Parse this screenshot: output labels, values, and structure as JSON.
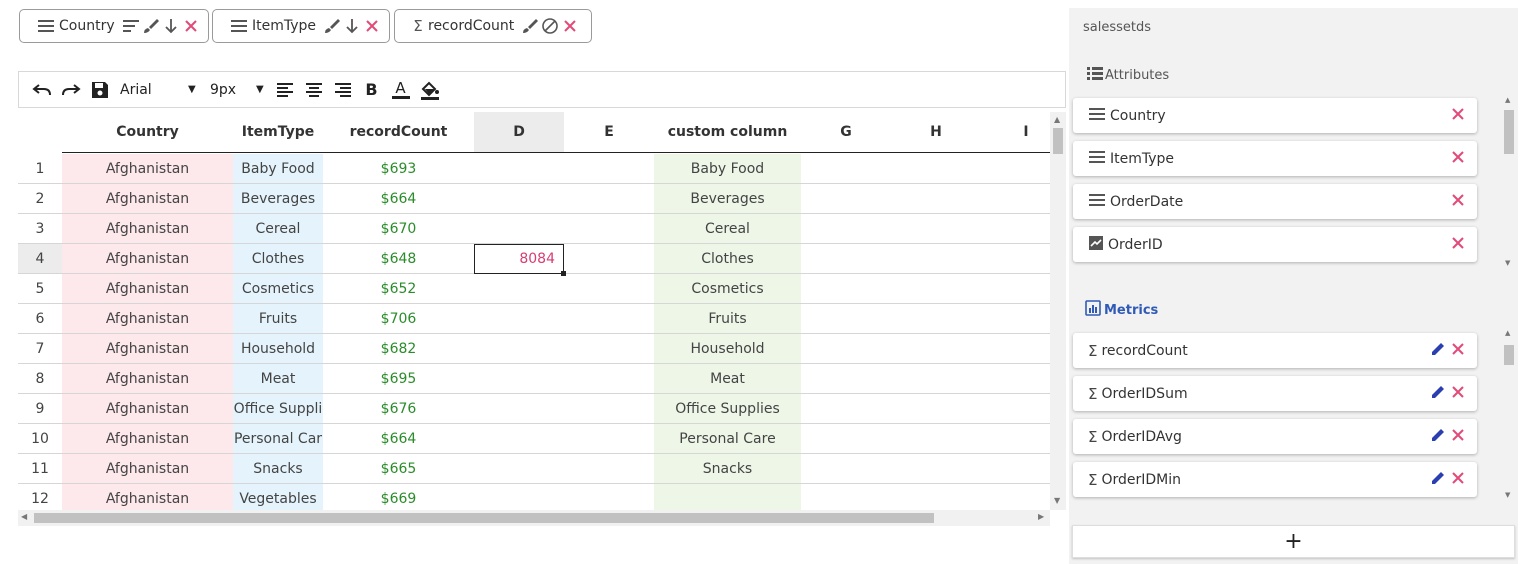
{
  "chips": [
    {
      "label": "Country"
    },
    {
      "label": "ItemType"
    },
    {
      "label": "recordCount"
    }
  ],
  "toolbar": {
    "font_family": "Arial",
    "font_size": "9px",
    "bold_label": "B",
    "text_color_label": "A"
  },
  "grid": {
    "columns": [
      "Country",
      "ItemType",
      "recordCount",
      "D",
      "E",
      "custom column",
      "G",
      "H",
      "I"
    ],
    "rows": [
      {
        "num": "1",
        "country": "Afghanistan",
        "item": "Baby Food",
        "count": "$693",
        "custom": "Baby Food"
      },
      {
        "num": "2",
        "country": "Afghanistan",
        "item": "Beverages",
        "count": "$664",
        "custom": "Beverages"
      },
      {
        "num": "3",
        "country": "Afghanistan",
        "item": "Cereal",
        "count": "$670",
        "custom": "Cereal"
      },
      {
        "num": "4",
        "country": "Afghanistan",
        "item": "Clothes",
        "count": "$648",
        "custom": "Clothes"
      },
      {
        "num": "5",
        "country": "Afghanistan",
        "item": "Cosmetics",
        "count": "$652",
        "custom": "Cosmetics"
      },
      {
        "num": "6",
        "country": "Afghanistan",
        "item": "Fruits",
        "count": "$706",
        "custom": "Fruits"
      },
      {
        "num": "7",
        "country": "Afghanistan",
        "item": "Household",
        "count": "$682",
        "custom": "Household"
      },
      {
        "num": "8",
        "country": "Afghanistan",
        "item": "Meat",
        "count": "$695",
        "custom": "Meat"
      },
      {
        "num": "9",
        "country": "Afghanistan",
        "item": "Office Suppli",
        "count": "$676",
        "custom": "Office Supplies"
      },
      {
        "num": "10",
        "country": "Afghanistan",
        "item": "Personal Car",
        "count": "$664",
        "custom": "Personal Care"
      },
      {
        "num": "11",
        "country": "Afghanistan",
        "item": "Snacks",
        "count": "$665",
        "custom": "Snacks"
      },
      {
        "num": "12",
        "country": "Afghanistan",
        "item": "Vegetables",
        "count": "$669",
        "custom": ""
      }
    ],
    "selected_cell_value": "8084"
  },
  "panel": {
    "dataset_name": "salessetds",
    "attributes_title": "Attributes",
    "attributes": [
      "Country",
      "ItemType",
      "OrderDate",
      "OrderID"
    ],
    "metrics_title": "Metrics",
    "metrics": [
      "recordCount",
      "OrderIDSum",
      "OrderIDAvg",
      "OrderIDMin"
    ],
    "add_label": "+"
  },
  "colors": {
    "accent_pink": "#e24a78",
    "metrics_blue": "#2f5bb7",
    "edit_blue": "#2b3fb0",
    "count_green": "#2a8c2a"
  }
}
